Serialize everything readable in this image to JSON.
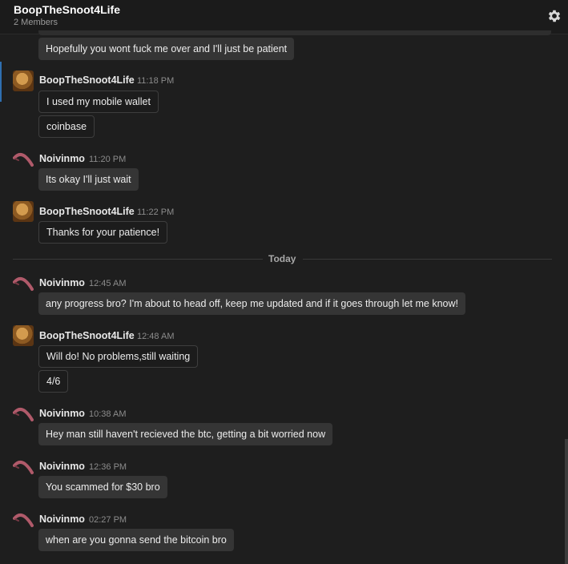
{
  "header": {
    "title": "BoopTheSnoot4Life",
    "members": "2 Members",
    "settings_icon": "gear-icon"
  },
  "divider": {
    "label": "Today"
  },
  "messages": [
    {
      "bubbles": [
        "Hopefully you wont fuck me over and I'll just be patient"
      ]
    },
    {
      "author": "BoopTheSnoot4Life",
      "time": "11:18 PM",
      "bubbles": [
        "I used my mobile wallet",
        "coinbase"
      ]
    },
    {
      "author": "Noivinmo",
      "time": "11:20 PM",
      "bubbles": [
        "Its okay I'll just wait"
      ]
    },
    {
      "author": "BoopTheSnoot4Life",
      "time": "11:22 PM",
      "bubbles": [
        "Thanks for your patience!"
      ]
    },
    {
      "author": "Noivinmo",
      "time": "12:45 AM",
      "bubbles": [
        "any progress bro? I'm about to head off, keep me updated and if it goes through let me know!"
      ]
    },
    {
      "author": "BoopTheSnoot4Life",
      "time": "12:48 AM",
      "bubbles": [
        "Will do! No problems,still waiting",
        "4/6"
      ]
    },
    {
      "author": "Noivinmo",
      "time": "10:38 AM",
      "bubbles": [
        "Hey man still haven't recieved the btc, getting a bit worried now"
      ]
    },
    {
      "author": "Noivinmo",
      "time": "12:36 PM",
      "bubbles": [
        "You scammed for $30 bro"
      ]
    },
    {
      "author": "Noivinmo",
      "time": "02:27 PM",
      "bubbles": [
        "when are you gonna send the bitcoin bro"
      ]
    }
  ]
}
